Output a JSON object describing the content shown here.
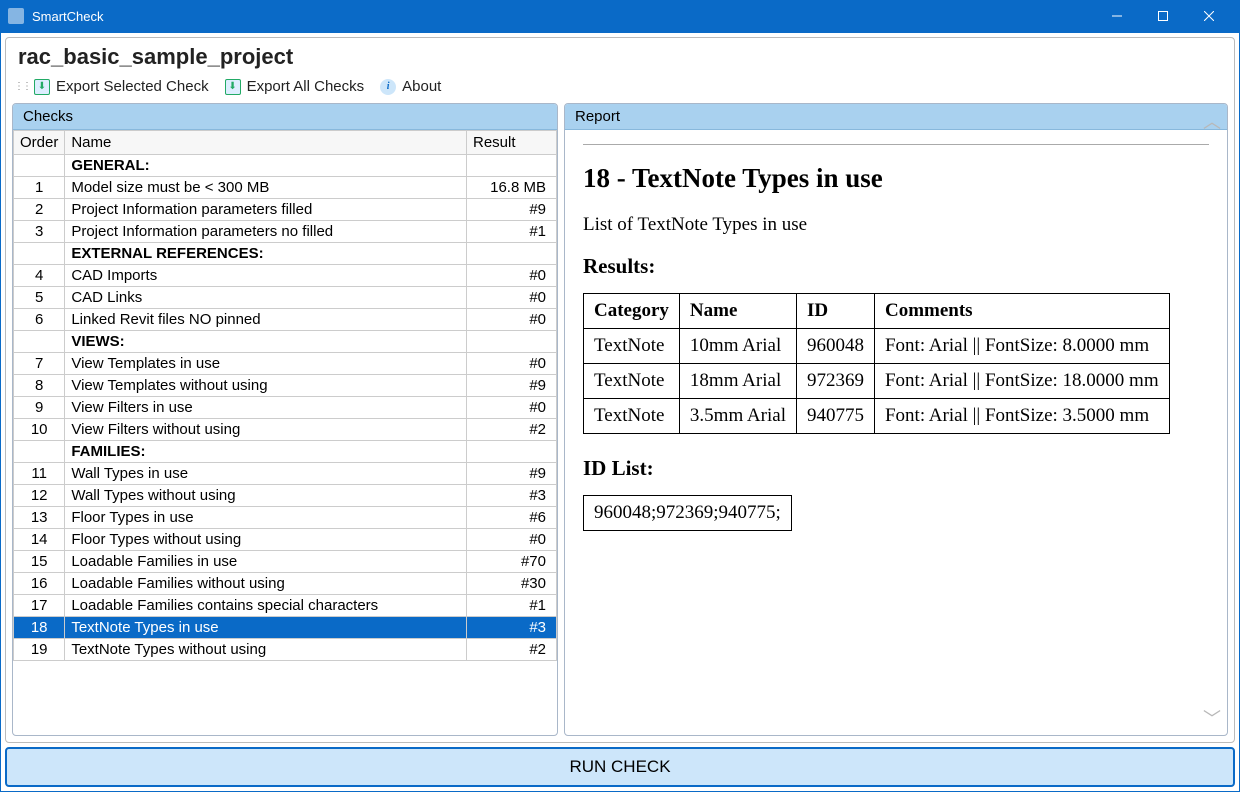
{
  "app": {
    "title": "SmartCheck"
  },
  "project": {
    "name": "rac_basic_sample_project"
  },
  "toolbar": {
    "export_selected": "Export Selected Check",
    "export_all": "Export All Checks",
    "about": "About"
  },
  "panels": {
    "checks": "Checks",
    "report": "Report"
  },
  "columns": {
    "order": "Order",
    "name": "Name",
    "result": "Result"
  },
  "checks": [
    {
      "type": "group",
      "name": "GENERAL:"
    },
    {
      "order": "1",
      "name": "Model size must be < 300 MB",
      "result": "16.8 MB"
    },
    {
      "order": "2",
      "name": "Project Information parameters filled",
      "result": "#9"
    },
    {
      "order": "3",
      "name": "Project Information parameters no filled",
      "result": "#1"
    },
    {
      "type": "group",
      "name": "EXTERNAL REFERENCES:"
    },
    {
      "order": "4",
      "name": "CAD Imports",
      "result": "#0"
    },
    {
      "order": "5",
      "name": "CAD Links",
      "result": "#0"
    },
    {
      "order": "6",
      "name": "Linked Revit files NO pinned",
      "result": "#0"
    },
    {
      "type": "group",
      "name": "VIEWS:"
    },
    {
      "order": "7",
      "name": "View Templates in use",
      "result": "#0"
    },
    {
      "order": "8",
      "name": "View Templates without using",
      "result": "#9"
    },
    {
      "order": "9",
      "name": "View Filters in use",
      "result": "#0"
    },
    {
      "order": "10",
      "name": "View Filters without using",
      "result": "#2"
    },
    {
      "type": "group",
      "name": "FAMILIES:"
    },
    {
      "order": "11",
      "name": "Wall Types in use",
      "result": "#9"
    },
    {
      "order": "12",
      "name": "Wall Types without using",
      "result": "#3"
    },
    {
      "order": "13",
      "name": "Floor Types in use",
      "result": "#6"
    },
    {
      "order": "14",
      "name": "Floor Types without using",
      "result": "#0"
    },
    {
      "order": "15",
      "name": "Loadable Families in use",
      "result": "#70"
    },
    {
      "order": "16",
      "name": "Loadable Families without using",
      "result": "#30"
    },
    {
      "order": "17",
      "name": "Loadable Families contains special characters",
      "result": "#1"
    },
    {
      "order": "18",
      "name": "TextNote Types in use",
      "result": "#3",
      "selected": true
    },
    {
      "order": "19",
      "name": "TextNote Types without using",
      "result": "#2"
    }
  ],
  "report": {
    "title": "18 - TextNote Types in use",
    "subtitle": "List of TextNote Types in use",
    "results_heading": "Results:",
    "headers": {
      "category": "Category",
      "name": "Name",
      "id": "ID",
      "comments": "Comments"
    },
    "rows": [
      {
        "category": "TextNote",
        "name": "10mm Arial",
        "id": "960048",
        "comments": "Font: Arial || FontSize: 8.0000 mm"
      },
      {
        "category": "TextNote",
        "name": "18mm Arial",
        "id": "972369",
        "comments": "Font: Arial || FontSize: 18.0000 mm"
      },
      {
        "category": "TextNote",
        "name": "3.5mm Arial",
        "id": "940775",
        "comments": "Font: Arial || FontSize: 3.5000 mm"
      }
    ],
    "idlist_heading": "ID List:",
    "idlist": "960048;972369;940775;"
  },
  "run": {
    "label": "RUN CHECK"
  }
}
